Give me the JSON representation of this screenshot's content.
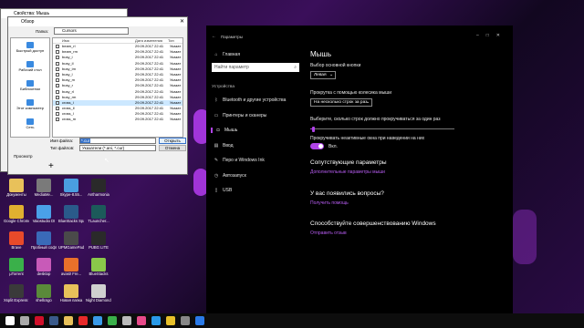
{
  "dialog_mouse": {
    "title": "Свойства: Мышь"
  },
  "dialog_browse": {
    "title": "Обзор",
    "folder_label": "Папка:",
    "folder_value": "Cursors",
    "col_name": "Имя",
    "col_date": "Дата изменения",
    "col_type": "Тип",
    "places": [
      {
        "label": "Быстрый доступ",
        "icon": "star-icon"
      },
      {
        "label": "Рабочий стол",
        "icon": "desktop-icon"
      },
      {
        "label": "Библиотеки",
        "icon": "library-icon"
      },
      {
        "label": "Этот компьютер",
        "icon": "computer-icon"
      },
      {
        "label": "Сеть",
        "icon": "network-icon"
      }
    ],
    "files": [
      {
        "name": "beam_rl",
        "date": "29.09.2017 22:41",
        "type": "Указат"
      },
      {
        "name": "beam_rm",
        "date": "29.09.2017 22:41",
        "type": "Указат"
      },
      {
        "name": "busy_i",
        "date": "29.09.2017 22:41",
        "type": "Указат"
      },
      {
        "name": "busy_il",
        "date": "29.09.2017 22:41",
        "type": "Указат"
      },
      {
        "name": "busy_im",
        "date": "29.09.2017 22:41",
        "type": "Указат"
      },
      {
        "name": "busy_l",
        "date": "29.09.2017 22:41",
        "type": "Указат"
      },
      {
        "name": "busy_m",
        "date": "29.09.2017 22:41",
        "type": "Указат"
      },
      {
        "name": "busy_r",
        "date": "29.09.2017 22:41",
        "type": "Указат"
      },
      {
        "name": "busy_rl",
        "date": "29.09.2017 22:41",
        "type": "Указат"
      },
      {
        "name": "busy_rm",
        "date": "29.09.2017 22:41",
        "type": "Указат"
      },
      {
        "name": "cross_i",
        "date": "29.09.2017 22:41",
        "type": "Указат"
      },
      {
        "name": "cross_il",
        "date": "29.09.2017 22:41",
        "type": "Указат"
      },
      {
        "name": "cross_l",
        "date": "29.09.2017 22:41",
        "type": "Указат"
      },
      {
        "name": "cross_m",
        "date": "29.09.2017 22:41",
        "type": "Указат"
      }
    ],
    "filename_label": "Имя файла:",
    "filename_value": "*.cur",
    "filetype_label": "Тип файлов:",
    "filetype_value": "Указатели (*.ani, *.cur)",
    "open_button": "Открыть",
    "cancel_button": "Отмена",
    "preview_label": "Просмотр"
  },
  "settings": {
    "window_title": "Параметры",
    "page_title": "Мышь",
    "search_placeholder": "Найти параметр",
    "home_label": "Главная",
    "section_label": "Устройства",
    "nav": [
      {
        "label": "Bluetooth и другие устройства",
        "icon": "bluetooth-icon",
        "glyph": "ᛒ"
      },
      {
        "label": "Принтеры и сканеры",
        "icon": "printer-icon",
        "glyph": "▭"
      },
      {
        "label": "Мышь",
        "icon": "mouse-icon",
        "glyph": "◘"
      },
      {
        "label": "Ввод",
        "icon": "keyboard-icon",
        "glyph": "▤"
      },
      {
        "label": "Перо и Windows Ink",
        "icon": "pen-icon",
        "glyph": "✎"
      },
      {
        "label": "Автозапуск",
        "icon": "autoplay-icon",
        "glyph": "◷"
      },
      {
        "label": "USB",
        "icon": "usb-icon",
        "glyph": "▯"
      }
    ],
    "primary_button_label": "Выбор основной кнопки",
    "primary_button_value": "Левая",
    "scroll_label": "Прокрутка с помощью колесика мыши",
    "scroll_value": "На несколько строк за раз",
    "lines_label": "Выберите, сколько строк должно прокручиваться за один раз",
    "lines_fraction": 0.02,
    "inactive_label": "Прокручивать неактивные окна при наведении на них",
    "inactive_value": "Вкл.",
    "related_title": "Сопутствующие параметры",
    "related_link": "Дополнительные параметры мыши",
    "question_title": "У вас появились вопросы?",
    "help_link": "Получить помощь",
    "improve_title": "Способствуйте совершенствованию Windows",
    "feedback_link": "Отправить отзыв"
  },
  "desktop": {
    "icons": [
      {
        "label": "Документы",
        "color": "#e8c15a"
      },
      {
        "label": "MediaMe...",
        "color": "#7a7a7a"
      },
      {
        "label": "Skype-8.55...",
        "color": "#4a9ee0"
      },
      {
        "label": "Antharmonia",
        "color": "#2a2a2a"
      },
      {
        "label": "Google Chrome",
        "color": "#e0b030"
      },
      {
        "label": "Vaiostudio DI",
        "color": "#4aa0e8"
      },
      {
        "label": "BlueStacks Space",
        "color": "#2a5a8a"
      },
      {
        "label": "TLauncher...",
        "color": "#1c5a5a"
      },
      {
        "label": "Brave",
        "color": "#e84a2a"
      },
      {
        "label": "Пробный софт",
        "color": "#3a6ab8"
      },
      {
        "label": "UPMGamePad",
        "color": "#4a4a4a"
      },
      {
        "label": "PUBG LITE",
        "color": "#2a2a2a"
      },
      {
        "label": "µTorrent",
        "color": "#3ab04a"
      },
      {
        "label": "desktop",
        "color": "#c85ab8"
      },
      {
        "label": "avast! Fre...",
        "color": "#e8702a"
      },
      {
        "label": "BlueStacks",
        "color": "#8ac84a"
      },
      {
        "label": "Xsplit Express Video Editor",
        "color": "#3a3a3a"
      },
      {
        "label": "shellcsgo",
        "color": "#5a8a3a"
      },
      {
        "label": "Новая папка",
        "color": "#e8c15a"
      },
      {
        "label": "Night Diamond...",
        "color": "#d0d0d0"
      }
    ]
  },
  "taskbar": {
    "items": [
      {
        "icon": "windows-start-icon",
        "color": "#ffffff"
      },
      {
        "icon": "cortana-icon",
        "color": "#aaaaaa"
      },
      {
        "icon": "opera-icon",
        "color": "#d0102a"
      },
      {
        "icon": "steam-icon",
        "color": "#3a5a8a"
      },
      {
        "icon": "file-explorer-icon",
        "color": "#e8c15a"
      },
      {
        "icon": "yandex-icon",
        "color": "#e82a2a"
      },
      {
        "icon": "media-player-icon",
        "color": "#3a9ae8"
      },
      {
        "icon": "bluestacks-icon",
        "color": "#3ab04a"
      },
      {
        "icon": "settings-gear-icon",
        "color": "#bbbbbb"
      },
      {
        "icon": "music-icon",
        "color": "#e84a8a"
      },
      {
        "icon": "skype-icon",
        "color": "#2a9ae8"
      },
      {
        "icon": "chrome-icon",
        "color": "#e8c02a"
      },
      {
        "icon": "mouse-props-icon",
        "color": "#888888"
      },
      {
        "icon": "photoshop-icon",
        "color": "#2a7ae8"
      }
    ]
  }
}
